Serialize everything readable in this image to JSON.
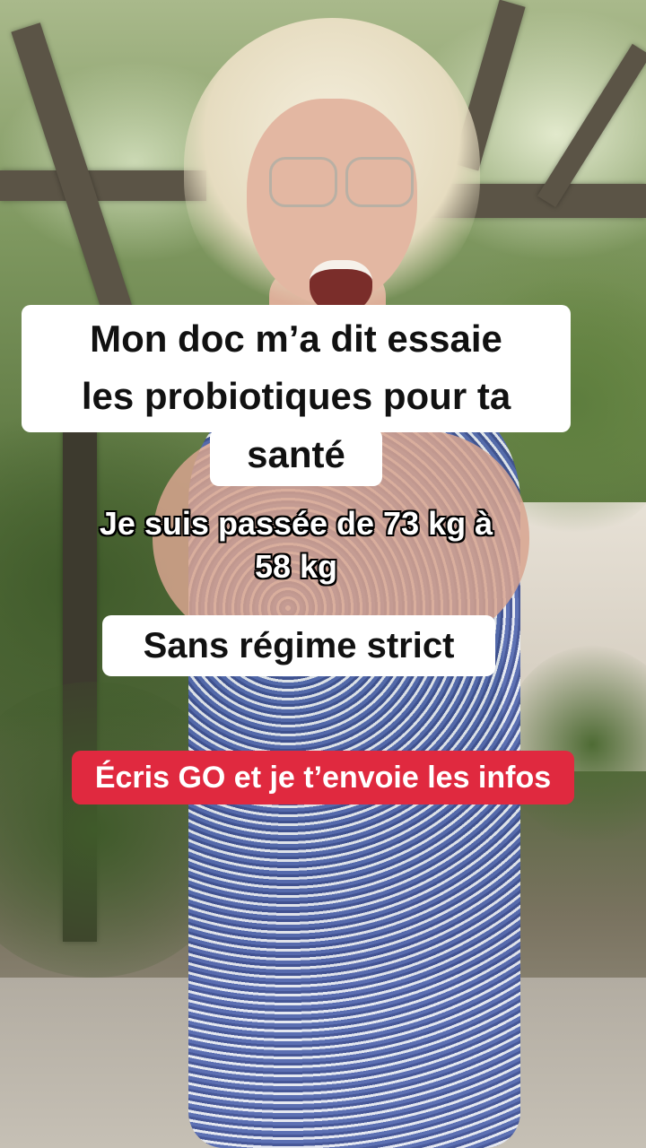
{
  "captions": {
    "main_line1": "Mon doc m’a dit essaie",
    "main_line2": "les probiotiques pour ta",
    "main_line3": "santé",
    "weight_line1": "Je suis passée de 73 kg à",
    "weight_line2": "58 kg",
    "no_diet": "Sans régime strict",
    "cta": "Écris GO et je t’envoie les infos"
  },
  "colors": {
    "caption_bg": "#ffffff",
    "cta_bg": "#e0293f"
  }
}
